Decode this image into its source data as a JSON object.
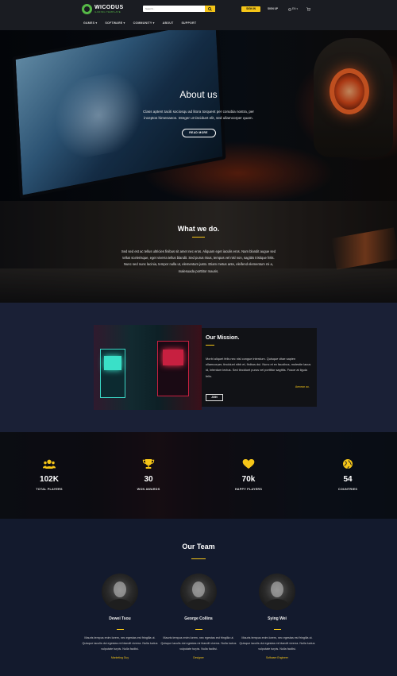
{
  "header": {
    "logo_name": "WICODUS",
    "logo_tagline": "GAMING TEMPLATE",
    "search_placeholder": "Search...",
    "signin_label": "SIGN IN",
    "signup_label": "SIGN UP",
    "language": "EN",
    "nav": [
      {
        "label": "GAMES ▾"
      },
      {
        "label": "SOFTWARE ▾"
      },
      {
        "label": "COMMUNITY ▾"
      },
      {
        "label": "ABOUT"
      },
      {
        "label": "SUPPORT"
      }
    ]
  },
  "hero": {
    "title": "About us",
    "text": "Class aptent taciti sociosqu ad litora torquent per conubia nostra, per inceptos himenaeos. Integer ut tincidunt elit, sed ullamcorper quam.",
    "button_label": "READ MORE"
  },
  "whatwedo": {
    "title": "What we do.",
    "text": "Sed sed est ac tellus ultricies finibus sit amet nec eros. Aliquam eget iaculis eros. Nam blandit augue sed tellus scelerisque, eget viverra tellus blandit. Sed purus risus, tempus vel nisl non, sagittis tristique felis. Nunc sed nunc lacinia, tempor nulla ut, elementum justo. Etiam metus ante, eleifend elementum mi a, malesuada porttitor mauris."
  },
  "mission": {
    "title": "Our Mission.",
    "text": "Morbi aliquet felis nec nisl congue interdum. Quisque vitae sapien ullamcorper, tincidunt nibh et, finibus dui. Nunc et ex faucibus, molestie lacus id, interdum lectus. Sed tincidunt purus vel porttitor sagittis. Fusce at ligula felis.",
    "signature": "Aenean ac.",
    "button_label": "JOIN"
  },
  "stats": [
    {
      "icon": "users-icon",
      "value": "102K",
      "label": "TOTAL PLAYERS"
    },
    {
      "icon": "trophy-icon",
      "value": "30",
      "label": "WON AWARDS"
    },
    {
      "icon": "heart-icon",
      "value": "70k",
      "label": "HAPPY PLAYERS"
    },
    {
      "icon": "globe-icon",
      "value": "54",
      "label": "COUNTRIES"
    }
  ],
  "team": {
    "title": "Our Team",
    "members": [
      {
        "name": "Dewei Tsou",
        "bio": "Mauris tempus enim lorem, nec egestas est fringilla ut. Quisque iaculis dui egestas mi blandit viverra. Nulla luctus vulputate turpis. Nulla facilisi.",
        "role": "Marketing Guy"
      },
      {
        "name": "George Collins",
        "bio": "Mauris tempus enim lorem, nec egestas est fringilla ut. Quisque iaculis dui egestas mi blandit viverra. Nulla luctus vulputate turpis. Nulla facilisi.",
        "role": "Designer"
      },
      {
        "name": "Sying Wei",
        "bio": "Mauris tempus enim lorem, nec egestas est fringilla ut. Quisque iaculis dui egestas mi blandit viverra. Nulla luctus vulputate turpis. Nulla facilisi.",
        "role": "Software Engineer"
      }
    ]
  },
  "colors": {
    "accent": "#f5c518",
    "brand_green": "#56b947",
    "header_bg": "#1a1c22",
    "section_bg": "#1a2036"
  }
}
